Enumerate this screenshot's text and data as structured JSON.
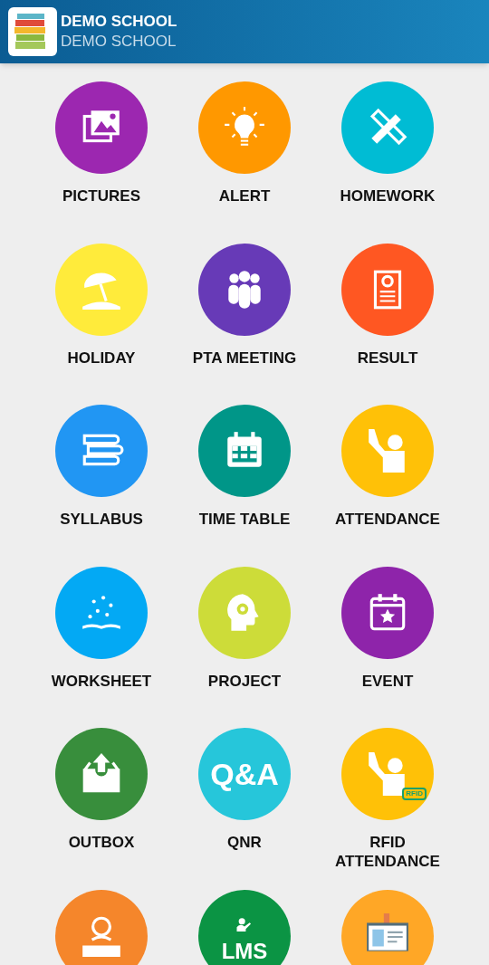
{
  "header": {
    "title": "DEMO SCHOOL",
    "subtitle": "DEMO SCHOOL"
  },
  "tiles": [
    {
      "kind": "pictures",
      "label": "PICTURES",
      "color": "#9c27b0"
    },
    {
      "kind": "alert",
      "label": "ALERT",
      "color": "#ff9800"
    },
    {
      "kind": "homework",
      "label": "HOMEWORK",
      "color": "#00bcd4"
    },
    {
      "kind": "holiday",
      "label": "HOLIDAY",
      "color": "#ffeb3b"
    },
    {
      "kind": "meeting",
      "label": "PTA MEETING",
      "color": "#673ab7"
    },
    {
      "kind": "result",
      "label": "RESULT",
      "color": "#ff5722"
    },
    {
      "kind": "syllabus",
      "label": "SYLLABUS",
      "color": "#2196f3"
    },
    {
      "kind": "timetable",
      "label": "TIME TABLE",
      "color": "#009688"
    },
    {
      "kind": "attendance",
      "label": "ATTENDANCE",
      "color": "#ffc107"
    },
    {
      "kind": "worksheet",
      "label": "WORKSHEET",
      "color": "#03a9f4"
    },
    {
      "kind": "project",
      "label": "PROJECT",
      "color": "#cddc39"
    },
    {
      "kind": "event",
      "label": "EVENT",
      "color": "#8e24aa"
    },
    {
      "kind": "outbox",
      "label": "OUTBOX",
      "color": "#388e3c"
    },
    {
      "kind": "qnr",
      "label": "QNR",
      "color": "#26c6da",
      "icon_text": "Q&A"
    },
    {
      "kind": "rfid",
      "label": "RFID\nATTENDANCE",
      "color": "#ffc107",
      "icon_text": "RFID"
    },
    {
      "kind": "reader",
      "color": "#f5862b"
    },
    {
      "kind": "lms",
      "color": "#0b9444",
      "icon_text": "LMS"
    },
    {
      "kind": "idcard",
      "color": "#ffa726"
    }
  ]
}
